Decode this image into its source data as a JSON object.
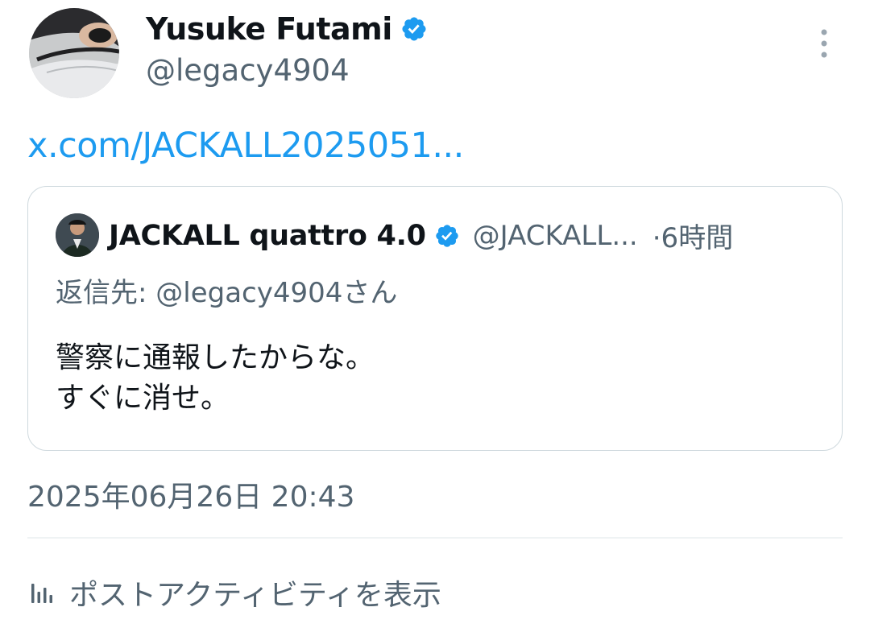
{
  "author": {
    "name": "Yusuke Futami",
    "handle": "@legacy4904"
  },
  "tweet": {
    "link_text": "x.com/JACKALL2025051..."
  },
  "quote": {
    "name": "JACKALL quattro 4.0",
    "handle": "@JACKALL...",
    "time": "·6時間",
    "reply_to": "返信先: @legacy4904さん",
    "text_line1": "警察に通報したからな。",
    "text_line2": "すぐに消せ。"
  },
  "timestamp": "2025年06月26日 20:43",
  "activity_label": "ポストアクティビティを表示",
  "icons": {
    "verified": "verified-badge-icon",
    "more": "more-vertical-icon",
    "activity": "bar-chart-icon"
  },
  "colors": {
    "link": "#1d9bf0",
    "secondary_text": "#536471",
    "border": "#cfd9de"
  }
}
